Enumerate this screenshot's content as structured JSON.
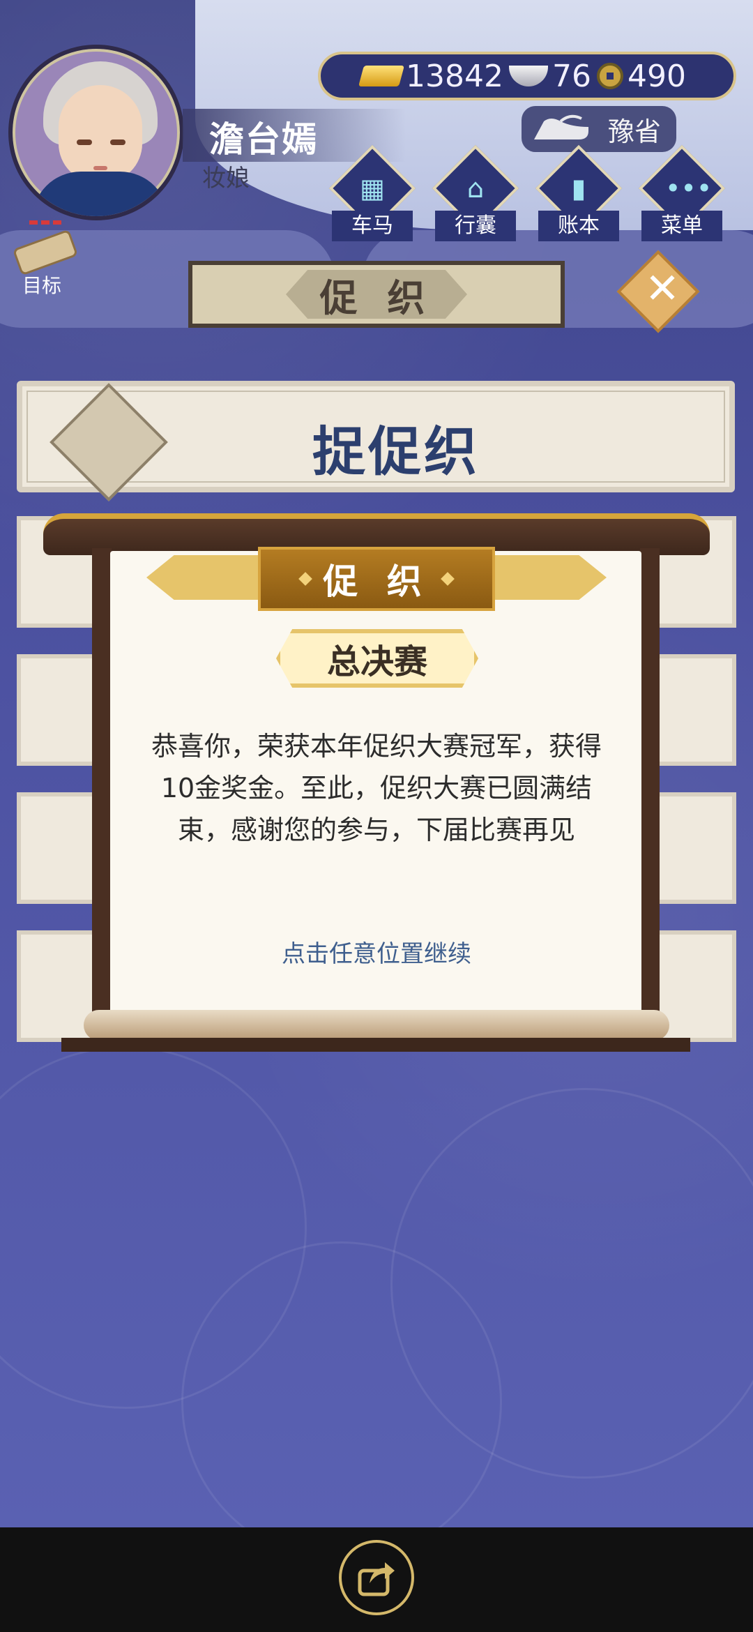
{
  "player": {
    "name": "澹台嫣",
    "title": "妆娘"
  },
  "currency": {
    "gold": "13842",
    "silver": "76",
    "coin": "490"
  },
  "location": "豫省",
  "nav": {
    "carriage": "车马",
    "bag": "行囊",
    "ledger": "账本",
    "menu": "菜单"
  },
  "goal_label": "目标",
  "page_title": "促 织",
  "event_title": "捉促织",
  "dialog": {
    "ribbon_title": "促 织",
    "stage": "总决赛",
    "message": "恭喜你，荣获本年促织大赛冠军，获得10金奖金。至此，促织大赛已圆满结束，感谢您的参与，下届比赛再见",
    "hint": "点击任意位置继续"
  },
  "icons": {
    "gold": "gold-bar-icon",
    "silver": "silver-ingot-icon",
    "coin": "copper-coin-icon",
    "location": "iron-icon",
    "close": "close-icon",
    "share": "share-icon"
  },
  "colors": {
    "accent_gold": "#e6c46a",
    "dialog_paper": "#fbf8f0",
    "hint_text": "#3f5f8e",
    "title_text": "#2c3f6e"
  }
}
